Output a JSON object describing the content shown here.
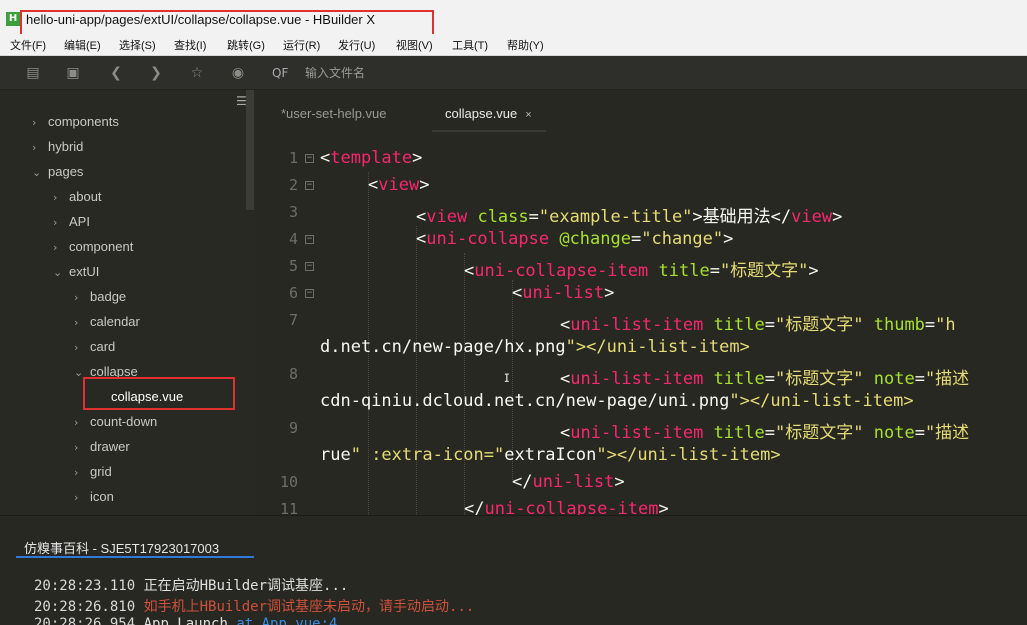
{
  "window": {
    "title": "hello-uni-app/pages/extUI/collapse/collapse.vue - HBuilder X",
    "app_icon": "H"
  },
  "menu": [
    "文件(F)",
    "编辑(E)",
    "选择(S)",
    "查找(I)",
    "跳转(G)",
    "运行(R)",
    "发行(U)",
    "视图(V)",
    "工具(T)",
    "帮助(Y)"
  ],
  "toolbar": {
    "icons": [
      "new-file-icon",
      "save-icon",
      "back-icon",
      "forward-icon",
      "favorite-icon",
      "run-icon"
    ],
    "search_icon": "QF",
    "search_placeholder": "输入文件名"
  },
  "sidebar": {
    "items": [
      {
        "label": "components",
        "expanded": false
      },
      {
        "label": "hybrid",
        "expanded": false
      },
      {
        "label": "pages",
        "expanded": true
      },
      {
        "label": "about",
        "expanded": false
      },
      {
        "label": "API",
        "expanded": false
      },
      {
        "label": "component",
        "expanded": false
      },
      {
        "label": "extUI",
        "expanded": true
      },
      {
        "label": "badge",
        "expanded": false
      },
      {
        "label": "calendar",
        "expanded": false
      },
      {
        "label": "card",
        "expanded": false
      },
      {
        "label": "collapse",
        "expanded": true
      },
      {
        "label": "collapse.vue",
        "selected": true
      },
      {
        "label": "count-down",
        "expanded": false
      },
      {
        "label": "drawer",
        "expanded": false
      },
      {
        "label": "grid",
        "expanded": false
      },
      {
        "label": "icon",
        "expanded": false
      }
    ]
  },
  "editor": {
    "tabs": [
      {
        "label": "*user-set-help.vue",
        "active": false
      },
      {
        "label": "collapse.vue",
        "active": true,
        "close": "×"
      }
    ],
    "line_numbers": [
      "1",
      "2",
      "3",
      "4",
      "5",
      "6",
      "7",
      "8",
      "9",
      "10",
      "11"
    ],
    "lines": [
      "<template>",
      "<view>",
      "<view class=\"example-title\">基础用法</view>",
      "<uni-collapse @change=\"change\">",
      "<uni-collapse-item title=\"标题文字\">",
      "<uni-list>",
      "<uni-list-item title=\"标题文字\" thumb=\"h",
      "d.net.cn/new-page/hx.png\"></uni-list-item>",
      "<uni-list-item title=\"标题文字\" note=\"描述",
      "cdn-qiniu.dcloud.net.cn/new-page/uni.png\"></uni-list-item>",
      "<uni-list-item title=\"标题文字\" note=\"描述",
      "rue\" :extra-icon=\"extraIcon\"></uni-list-item>",
      "</uni-list>",
      "</uni-collapse-item>"
    ]
  },
  "console": {
    "tab": "仿糗事百科 - SJE5T17923017003",
    "logs": [
      {
        "time": "20:28:23.110",
        "msg": "正在启动HBuilder调试基座...",
        "type": "info"
      },
      {
        "time": "20:28:26.810",
        "msg": "如手机上HBuilder调试基座未启动，请手动启动...",
        "type": "warn"
      },
      {
        "time": "20:28:26.954",
        "msg": " App Launch",
        "link": " at App.vue:4",
        "type": "info"
      }
    ]
  },
  "colors": {
    "highlight_box": "#e03030",
    "tag": "#f92672",
    "attr": "#a6e22e",
    "string": "#e6db74"
  }
}
